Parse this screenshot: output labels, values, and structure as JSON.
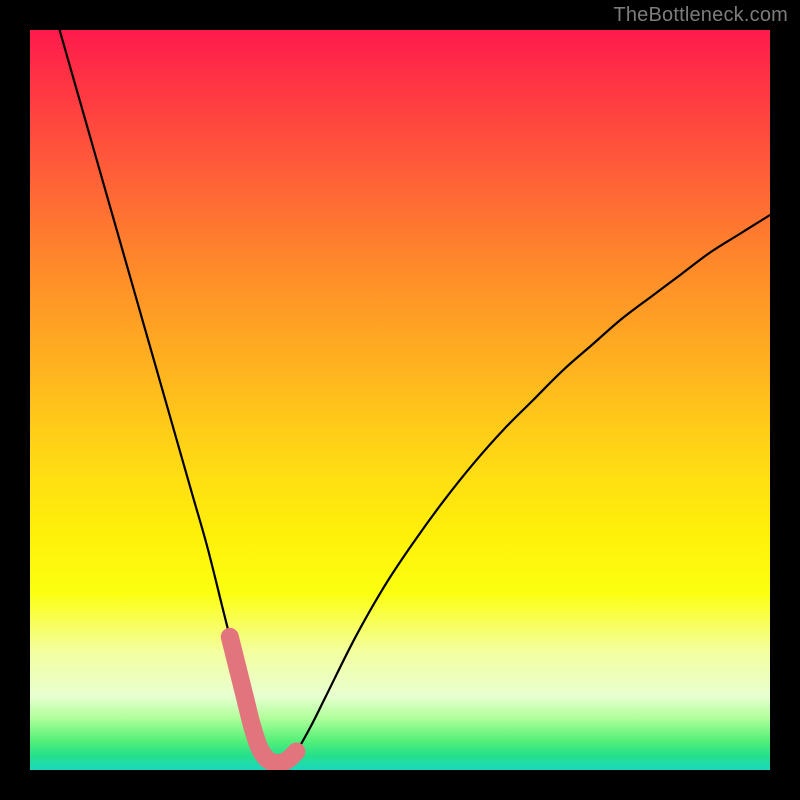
{
  "watermark": "TheBottleneck.com",
  "chart_data": {
    "type": "line",
    "title": "",
    "xlabel": "",
    "ylabel": "",
    "xlim": [
      0,
      100
    ],
    "ylim": [
      0,
      100
    ],
    "series": [
      {
        "name": "bottleneck-curve",
        "x": [
          4,
          6,
          8,
          10,
          12,
          14,
          16,
          18,
          20,
          22,
          24,
          26,
          27,
          28,
          29,
          30,
          31,
          32,
          33,
          34,
          35,
          36,
          38,
          40,
          44,
          48,
          52,
          56,
          60,
          64,
          68,
          72,
          76,
          80,
          84,
          88,
          92,
          96,
          100
        ],
        "values": [
          100,
          93,
          86,
          79,
          72,
          65,
          58,
          51,
          44,
          37,
          30,
          22,
          18,
          14,
          10,
          6,
          3,
          1.5,
          1,
          1,
          1.5,
          2.5,
          6,
          10,
          18,
          25,
          31,
          36.5,
          41.5,
          46,
          50,
          54,
          57.5,
          61,
          64,
          67,
          70,
          72.5,
          75
        ]
      },
      {
        "name": "highlight-band",
        "x": [
          27,
          28,
          29,
          30,
          31,
          32,
          33,
          34,
          35,
          36
        ],
        "values": [
          18,
          14,
          10,
          6,
          3,
          1.5,
          1,
          1,
          1.5,
          2.5
        ]
      }
    ],
    "highlight_color": "#e2747e",
    "curve_color": "#000000"
  }
}
